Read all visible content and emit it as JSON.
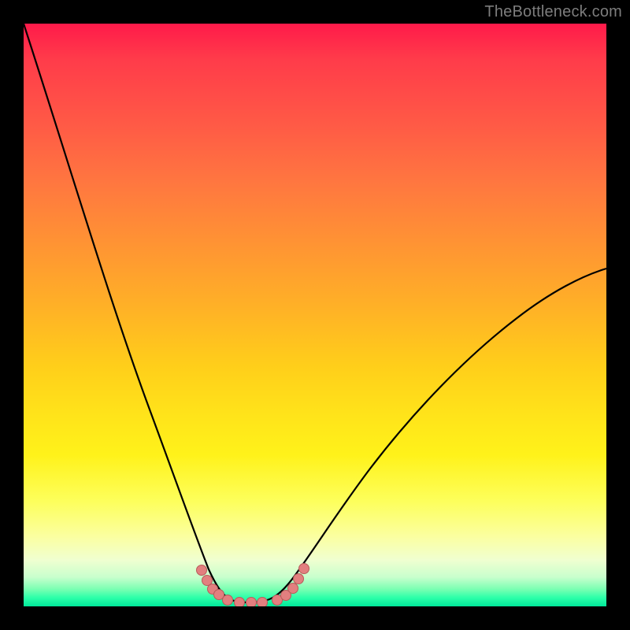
{
  "watermark": "TheBottleneck.com",
  "colors": {
    "page_bg": "#000000",
    "gradient_top": "#ff1a4a",
    "gradient_bottom": "#00e89a",
    "curve": "#000000",
    "marker_fill": "#e27f7f",
    "marker_stroke": "#b85a5a",
    "watermark": "#7d7d7d"
  },
  "chart_data": {
    "type": "line",
    "title": "",
    "xlabel": "",
    "ylabel": "",
    "x": [
      0.0,
      0.03,
      0.06,
      0.09,
      0.12,
      0.15,
      0.18,
      0.21,
      0.24,
      0.27,
      0.29,
      0.31,
      0.33,
      0.35,
      0.36,
      0.37,
      0.38,
      0.4,
      0.42,
      0.44,
      0.46,
      0.49,
      0.52,
      0.56,
      0.6,
      0.64,
      0.68,
      0.72,
      0.76,
      0.8,
      0.84,
      0.88,
      0.92,
      0.96,
      1.0
    ],
    "y": [
      1.0,
      0.9,
      0.8,
      0.7,
      0.6,
      0.5,
      0.41,
      0.32,
      0.24,
      0.16,
      0.11,
      0.07,
      0.04,
      0.02,
      0.01,
      0.0,
      0.0,
      0.0,
      0.0,
      0.01,
      0.02,
      0.04,
      0.07,
      0.11,
      0.15,
      0.2,
      0.25,
      0.3,
      0.35,
      0.4,
      0.45,
      0.49,
      0.53,
      0.56,
      0.58
    ],
    "xlim": [
      0,
      1
    ],
    "ylim": [
      0,
      1
    ],
    "markers": {
      "x": [
        0.305,
        0.315,
        0.325,
        0.335,
        0.35,
        0.37,
        0.39,
        0.41,
        0.435,
        0.45,
        0.462,
        0.472,
        0.481
      ],
      "y": [
        0.058,
        0.04,
        0.026,
        0.016,
        0.006,
        0.0,
        0.0,
        0.0,
        0.005,
        0.014,
        0.026,
        0.042,
        0.06
      ]
    }
  }
}
